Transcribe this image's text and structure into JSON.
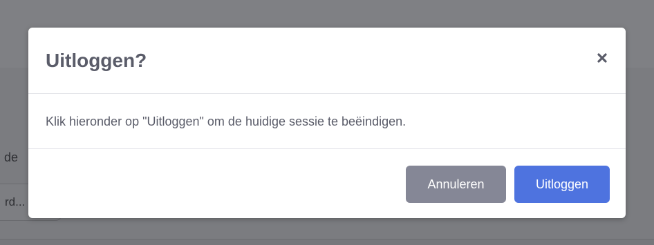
{
  "background": {
    "label_fragment": "de",
    "input_fragment": "rd..."
  },
  "modal": {
    "title": "Uitloggen?",
    "close_icon": "close-icon",
    "message": "Klik hieronder op \"Uitloggen\" om de huidige sessie te beëindigen.",
    "cancel_label": "Annuleren",
    "logout_label": "Uitloggen"
  },
  "colors": {
    "overlay": "#7d7e82",
    "title_text": "#5a5c69",
    "cancel_button": "#858796",
    "logout_button": "#4e73df"
  }
}
